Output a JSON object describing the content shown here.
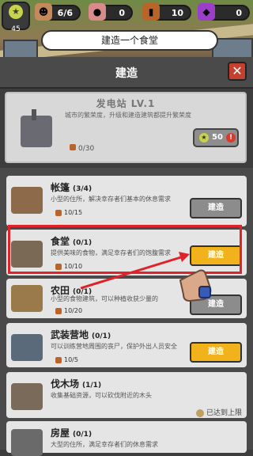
{
  "topbar": {
    "level": "45",
    "resources": [
      {
        "name": "survivors",
        "icon": "survivor-icon",
        "value": "6/6"
      },
      {
        "name": "meat",
        "icon": "meat-icon",
        "value": "0"
      },
      {
        "name": "wood",
        "icon": "wood-icon",
        "value": "10"
      },
      {
        "name": "gems",
        "icon": "gem-icon",
        "value": "0"
      }
    ]
  },
  "tip": "建造一个食堂",
  "header": {
    "title": "建造"
  },
  "power_station": {
    "title": "发电站 LV.1",
    "desc": "城市的繁荣度，升级和建造建筑都提升繁荣度",
    "cost": "0/30",
    "gem_cost": "50"
  },
  "items": [
    {
      "name": "帐篷",
      "count": "(3/4)",
      "desc": "小型的住所，解决幸存者们基本的休息需求",
      "cost": "10/15",
      "button": "建造",
      "state": "gray"
    },
    {
      "name": "食堂",
      "count": "(0/1)",
      "desc": "提供美味的食物，满足幸存者们的饱腹需求",
      "cost": "10/10",
      "button": "建造",
      "state": "yellow"
    },
    {
      "name": "农田",
      "count": "(0/1)",
      "desc": "小型的食物建筑，可以种植收获少量的",
      "cost": "10/20",
      "button": "建造",
      "state": "gray"
    },
    {
      "name": "武装营地",
      "count": "(0/1)",
      "desc": "可以训练营地周围的丧尸，保护外出人员安全",
      "cost": "10/5",
      "button": "建造",
      "state": "yellow"
    },
    {
      "name": "伐木场",
      "count": "(1/1)",
      "desc": "收集基础资源，可以砍伐附近的木头",
      "cost": "",
      "button": "已达到上限",
      "state": "maxed"
    },
    {
      "name": "房屋",
      "count": "(0/1)",
      "desc": "大型的住所，满足幸存者们的休息需求",
      "cost": "",
      "button": "",
      "state": "none"
    }
  ]
}
